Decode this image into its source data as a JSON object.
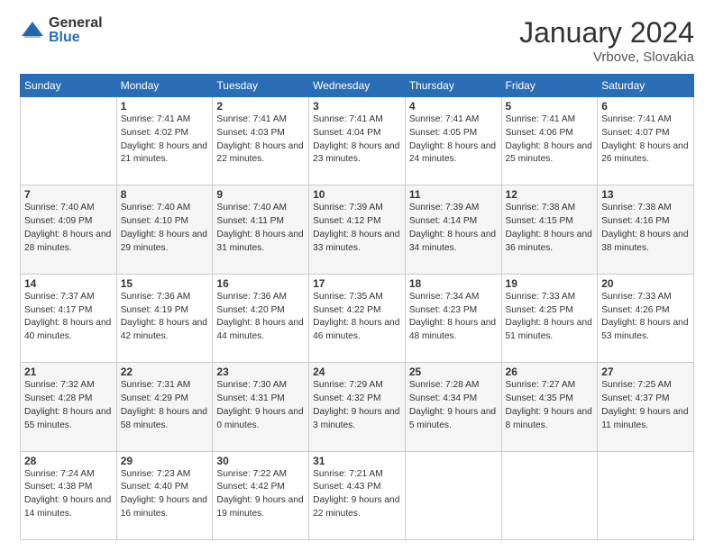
{
  "logo": {
    "general": "General",
    "blue": "Blue"
  },
  "header": {
    "month_year": "January 2024",
    "location": "Vrbove, Slovakia"
  },
  "days_of_week": [
    "Sunday",
    "Monday",
    "Tuesday",
    "Wednesday",
    "Thursday",
    "Friday",
    "Saturday"
  ],
  "weeks": [
    [
      {
        "day": "",
        "sunrise": "",
        "sunset": "",
        "daylight": ""
      },
      {
        "day": "1",
        "sunrise": "Sunrise: 7:41 AM",
        "sunset": "Sunset: 4:02 PM",
        "daylight": "Daylight: 8 hours and 21 minutes."
      },
      {
        "day": "2",
        "sunrise": "Sunrise: 7:41 AM",
        "sunset": "Sunset: 4:03 PM",
        "daylight": "Daylight: 8 hours and 22 minutes."
      },
      {
        "day": "3",
        "sunrise": "Sunrise: 7:41 AM",
        "sunset": "Sunset: 4:04 PM",
        "daylight": "Daylight: 8 hours and 23 minutes."
      },
      {
        "day": "4",
        "sunrise": "Sunrise: 7:41 AM",
        "sunset": "Sunset: 4:05 PM",
        "daylight": "Daylight: 8 hours and 24 minutes."
      },
      {
        "day": "5",
        "sunrise": "Sunrise: 7:41 AM",
        "sunset": "Sunset: 4:06 PM",
        "daylight": "Daylight: 8 hours and 25 minutes."
      },
      {
        "day": "6",
        "sunrise": "Sunrise: 7:41 AM",
        "sunset": "Sunset: 4:07 PM",
        "daylight": "Daylight: 8 hours and 26 minutes."
      }
    ],
    [
      {
        "day": "7",
        "sunrise": "Sunrise: 7:40 AM",
        "sunset": "Sunset: 4:09 PM",
        "daylight": "Daylight: 8 hours and 28 minutes."
      },
      {
        "day": "8",
        "sunrise": "Sunrise: 7:40 AM",
        "sunset": "Sunset: 4:10 PM",
        "daylight": "Daylight: 8 hours and 29 minutes."
      },
      {
        "day": "9",
        "sunrise": "Sunrise: 7:40 AM",
        "sunset": "Sunset: 4:11 PM",
        "daylight": "Daylight: 8 hours and 31 minutes."
      },
      {
        "day": "10",
        "sunrise": "Sunrise: 7:39 AM",
        "sunset": "Sunset: 4:12 PM",
        "daylight": "Daylight: 8 hours and 33 minutes."
      },
      {
        "day": "11",
        "sunrise": "Sunrise: 7:39 AM",
        "sunset": "Sunset: 4:14 PM",
        "daylight": "Daylight: 8 hours and 34 minutes."
      },
      {
        "day": "12",
        "sunrise": "Sunrise: 7:38 AM",
        "sunset": "Sunset: 4:15 PM",
        "daylight": "Daylight: 8 hours and 36 minutes."
      },
      {
        "day": "13",
        "sunrise": "Sunrise: 7:38 AM",
        "sunset": "Sunset: 4:16 PM",
        "daylight": "Daylight: 8 hours and 38 minutes."
      }
    ],
    [
      {
        "day": "14",
        "sunrise": "Sunrise: 7:37 AM",
        "sunset": "Sunset: 4:17 PM",
        "daylight": "Daylight: 8 hours and 40 minutes."
      },
      {
        "day": "15",
        "sunrise": "Sunrise: 7:36 AM",
        "sunset": "Sunset: 4:19 PM",
        "daylight": "Daylight: 8 hours and 42 minutes."
      },
      {
        "day": "16",
        "sunrise": "Sunrise: 7:36 AM",
        "sunset": "Sunset: 4:20 PM",
        "daylight": "Daylight: 8 hours and 44 minutes."
      },
      {
        "day": "17",
        "sunrise": "Sunrise: 7:35 AM",
        "sunset": "Sunset: 4:22 PM",
        "daylight": "Daylight: 8 hours and 46 minutes."
      },
      {
        "day": "18",
        "sunrise": "Sunrise: 7:34 AM",
        "sunset": "Sunset: 4:23 PM",
        "daylight": "Daylight: 8 hours and 48 minutes."
      },
      {
        "day": "19",
        "sunrise": "Sunrise: 7:33 AM",
        "sunset": "Sunset: 4:25 PM",
        "daylight": "Daylight: 8 hours and 51 minutes."
      },
      {
        "day": "20",
        "sunrise": "Sunrise: 7:33 AM",
        "sunset": "Sunset: 4:26 PM",
        "daylight": "Daylight: 8 hours and 53 minutes."
      }
    ],
    [
      {
        "day": "21",
        "sunrise": "Sunrise: 7:32 AM",
        "sunset": "Sunset: 4:28 PM",
        "daylight": "Daylight: 8 hours and 55 minutes."
      },
      {
        "day": "22",
        "sunrise": "Sunrise: 7:31 AM",
        "sunset": "Sunset: 4:29 PM",
        "daylight": "Daylight: 8 hours and 58 minutes."
      },
      {
        "day": "23",
        "sunrise": "Sunrise: 7:30 AM",
        "sunset": "Sunset: 4:31 PM",
        "daylight": "Daylight: 9 hours and 0 minutes."
      },
      {
        "day": "24",
        "sunrise": "Sunrise: 7:29 AM",
        "sunset": "Sunset: 4:32 PM",
        "daylight": "Daylight: 9 hours and 3 minutes."
      },
      {
        "day": "25",
        "sunrise": "Sunrise: 7:28 AM",
        "sunset": "Sunset: 4:34 PM",
        "daylight": "Daylight: 9 hours and 5 minutes."
      },
      {
        "day": "26",
        "sunrise": "Sunrise: 7:27 AM",
        "sunset": "Sunset: 4:35 PM",
        "daylight": "Daylight: 9 hours and 8 minutes."
      },
      {
        "day": "27",
        "sunrise": "Sunrise: 7:25 AM",
        "sunset": "Sunset: 4:37 PM",
        "daylight": "Daylight: 9 hours and 11 minutes."
      }
    ],
    [
      {
        "day": "28",
        "sunrise": "Sunrise: 7:24 AM",
        "sunset": "Sunset: 4:38 PM",
        "daylight": "Daylight: 9 hours and 14 minutes."
      },
      {
        "day": "29",
        "sunrise": "Sunrise: 7:23 AM",
        "sunset": "Sunset: 4:40 PM",
        "daylight": "Daylight: 9 hours and 16 minutes."
      },
      {
        "day": "30",
        "sunrise": "Sunrise: 7:22 AM",
        "sunset": "Sunset: 4:42 PM",
        "daylight": "Daylight: 9 hours and 19 minutes."
      },
      {
        "day": "31",
        "sunrise": "Sunrise: 7:21 AM",
        "sunset": "Sunset: 4:43 PM",
        "daylight": "Daylight: 9 hours and 22 minutes."
      },
      {
        "day": "",
        "sunrise": "",
        "sunset": "",
        "daylight": ""
      },
      {
        "day": "",
        "sunrise": "",
        "sunset": "",
        "daylight": ""
      },
      {
        "day": "",
        "sunrise": "",
        "sunset": "",
        "daylight": ""
      }
    ]
  ]
}
